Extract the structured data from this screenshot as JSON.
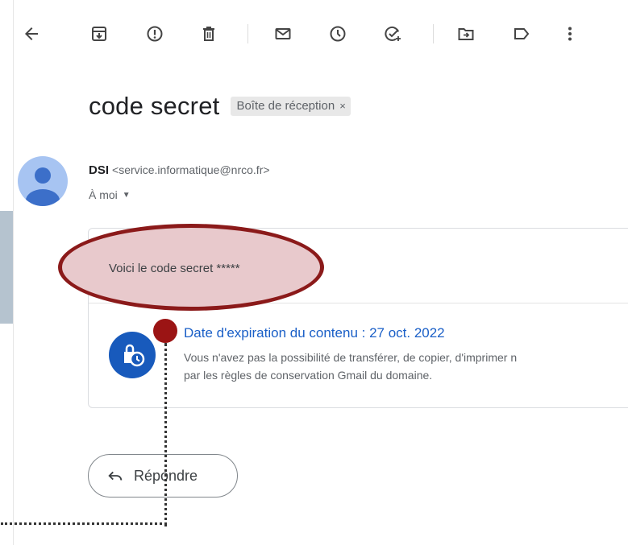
{
  "toolbar": {
    "icons": [
      "back-arrow-icon",
      "archive-icon",
      "report-spam-icon",
      "delete-icon",
      "mark-unread-icon",
      "snooze-icon",
      "add-task-icon",
      "move-to-icon",
      "label-icon",
      "more-vert-icon"
    ]
  },
  "email": {
    "subject": "code secret",
    "label_chip": "Boîte de réception",
    "label_remove": "×",
    "sender_name": "DSI",
    "sender_email": "<service.informatique@nrco.fr>",
    "recipient": "À moi",
    "recipient_caret": "▼",
    "body": "Voici le code secret *****"
  },
  "expiration": {
    "title": "Date d'expiration du contenu : 27 oct. 2022",
    "line1": "Vous n'avez pas la possibilité de transférer, de copier, d'imprimer n",
    "line2": "par les règles de conservation Gmail du domaine."
  },
  "actions": {
    "reply_label": "Répondre"
  },
  "colors": {
    "highlight_border": "#8b1a1a",
    "highlight_fill": "#e8c9cc",
    "expiry_link": "#1a5fc7",
    "clock_badge": "#185abc",
    "avatar": "#a7c4f2"
  }
}
